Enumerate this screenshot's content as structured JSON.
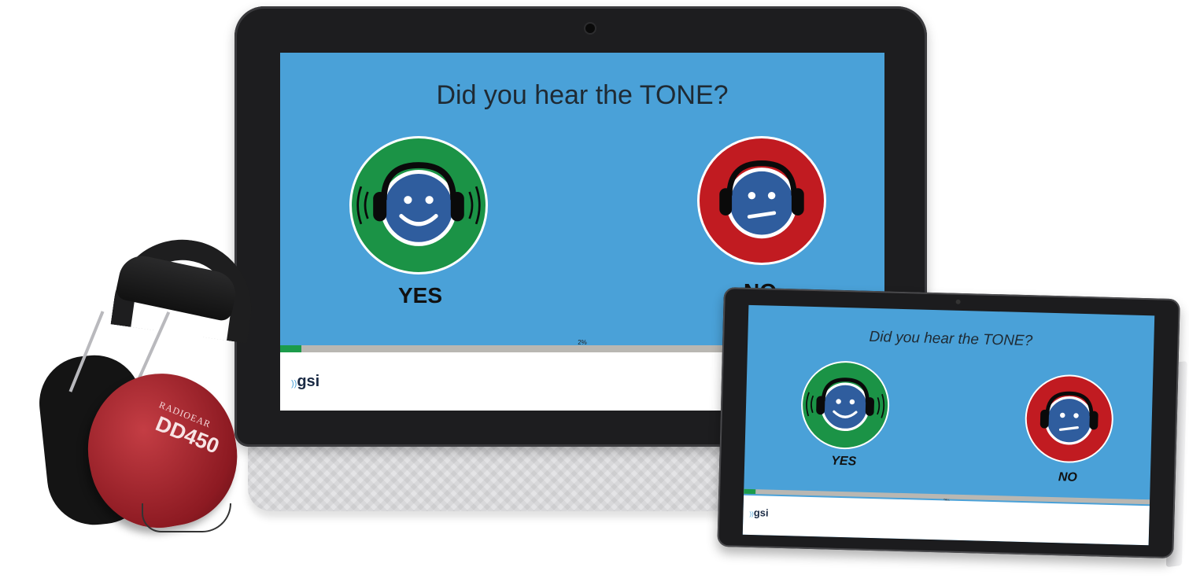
{
  "monitor": {
    "question": "Did you hear the TONE?",
    "yes_label": "YES",
    "no_label": "NO",
    "progress_text": "2%",
    "progress_fraction": 0.035,
    "logo_text": "gsi",
    "logo_wave": "))"
  },
  "tablet": {
    "question": "Did you hear the TONE?",
    "yes_label": "YES",
    "no_label": "NO",
    "progress_text": "2%",
    "progress_fraction": 0.03,
    "logo_text": "gsi",
    "logo_wave": "))"
  },
  "headphones": {
    "brand": "RADIOEAR",
    "model": "DD450"
  },
  "colors": {
    "screen_bg": "#4aa1d8",
    "yes_green": "#1b9346",
    "no_red": "#c11b21",
    "face_blue": "#2f5d9e",
    "progress_green": "#1c9b4b"
  },
  "icons": {
    "yes": "happy-face-headphones-icon",
    "no": "unsure-face-headphones-icon"
  }
}
